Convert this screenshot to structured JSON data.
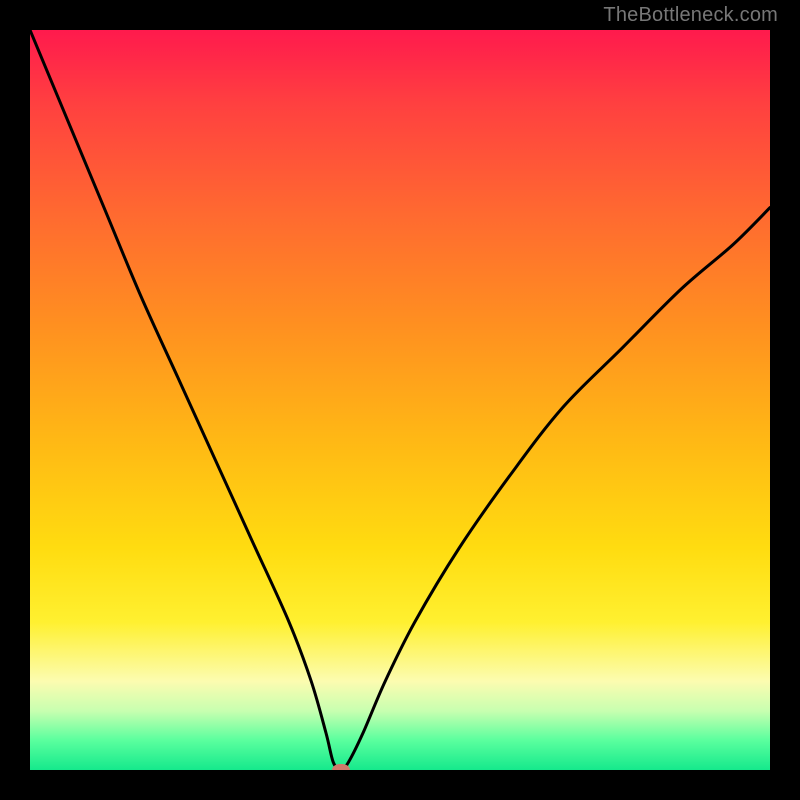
{
  "watermark": "TheBottleneck.com",
  "chart_data": {
    "type": "line",
    "title": "",
    "xlabel": "",
    "ylabel": "",
    "xlim": [
      0,
      100
    ],
    "ylim": [
      0,
      100
    ],
    "series": [
      {
        "name": "bottleneck-curve",
        "x": [
          0,
          5,
          10,
          15,
          20,
          25,
          30,
          35,
          38,
          40,
          41,
          42,
          43,
          45,
          48,
          52,
          58,
          65,
          72,
          80,
          88,
          95,
          100
        ],
        "y": [
          100,
          88,
          76,
          64,
          53,
          42,
          31,
          20,
          12,
          5,
          1,
          0,
          1,
          5,
          12,
          20,
          30,
          40,
          49,
          57,
          65,
          71,
          76
        ]
      }
    ],
    "markers": [
      {
        "name": "optimal-point",
        "x": 42,
        "y": 0
      }
    ],
    "gradient_stops": [
      {
        "pos": 0,
        "color": "#ff1a4d"
      },
      {
        "pos": 10,
        "color": "#ff4040"
      },
      {
        "pos": 25,
        "color": "#ff6a30"
      },
      {
        "pos": 40,
        "color": "#ff9020"
      },
      {
        "pos": 55,
        "color": "#ffb715"
      },
      {
        "pos": 70,
        "color": "#ffdc10"
      },
      {
        "pos": 80,
        "color": "#fff030"
      },
      {
        "pos": 88,
        "color": "#fcfcb0"
      },
      {
        "pos": 92,
        "color": "#c8ffb0"
      },
      {
        "pos": 96,
        "color": "#5aff9e"
      },
      {
        "pos": 100,
        "color": "#15e98c"
      }
    ]
  }
}
